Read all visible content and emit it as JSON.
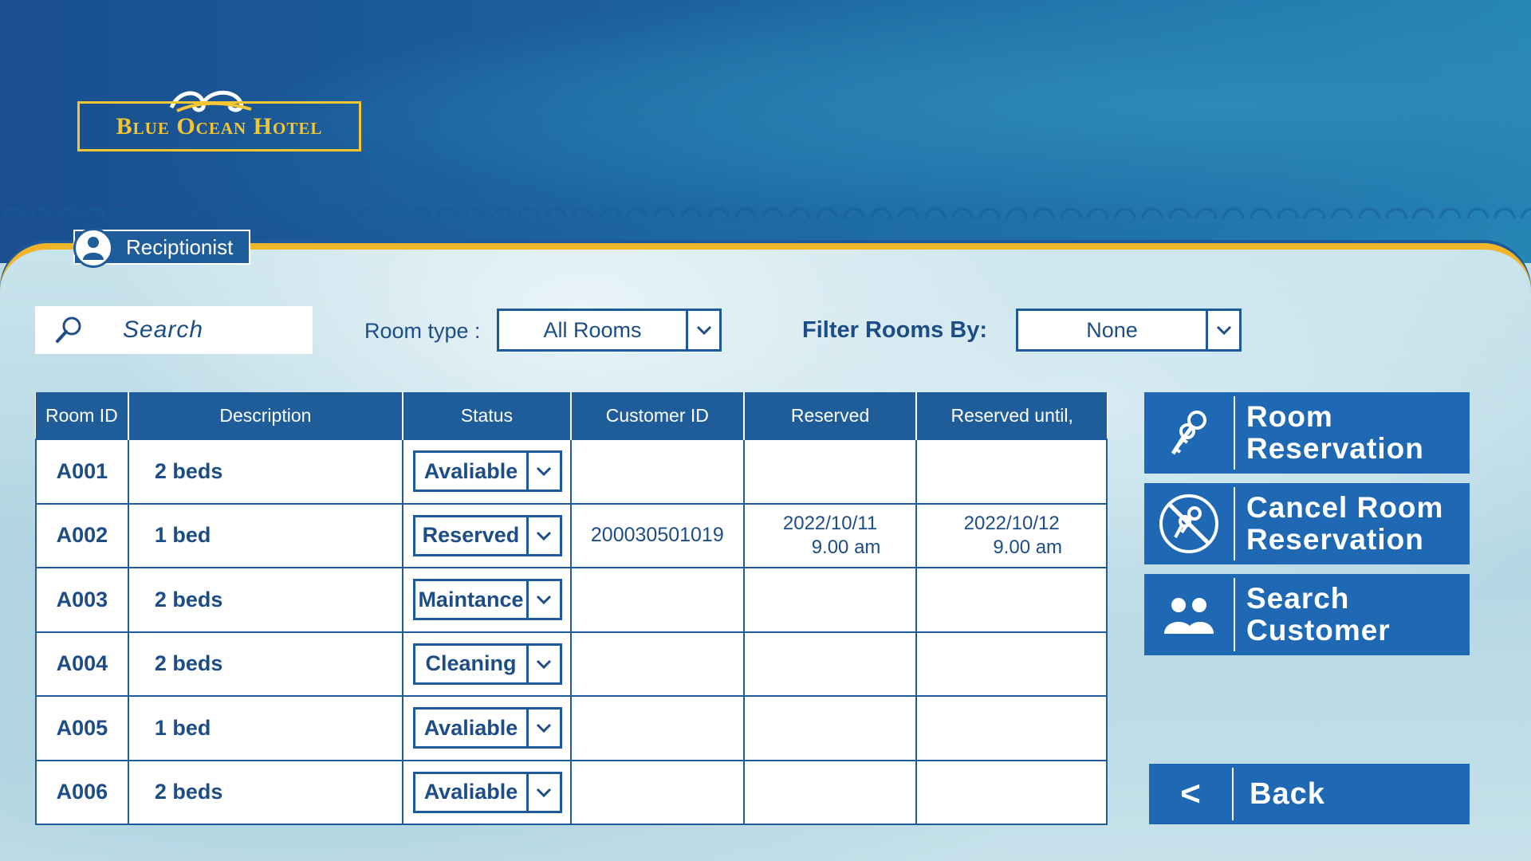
{
  "brand": {
    "name": "Blue Ocean Hotel"
  },
  "user": {
    "role": "Reciptionist"
  },
  "filters": {
    "search_placeholder": "Search",
    "room_type_label": "Room type :",
    "room_type_value": "All Rooms",
    "filter_by_label": "Filter Rooms By:",
    "filter_by_value": "None"
  },
  "table": {
    "headers": [
      "Room ID",
      "Description",
      "Status",
      "Customer ID",
      "Reserved",
      "Reserved until,"
    ],
    "rows": [
      {
        "id": "A001",
        "description": "2 beds",
        "status": "Avaliable",
        "customer_id": "",
        "reserved_date": "",
        "reserved_time": "",
        "until_date": "",
        "until_time": ""
      },
      {
        "id": "A002",
        "description": "1 bed",
        "status": "Reserved",
        "customer_id": "200030501019",
        "reserved_date": "2022/10/11",
        "reserved_time": "9.00 am",
        "until_date": "2022/10/12",
        "until_time": "9.00 am"
      },
      {
        "id": "A003",
        "description": "2 beds",
        "status": "Maintance",
        "customer_id": "",
        "reserved_date": "",
        "reserved_time": "",
        "until_date": "",
        "until_time": ""
      },
      {
        "id": "A004",
        "description": "2 beds",
        "status": "Cleaning",
        "customer_id": "",
        "reserved_date": "",
        "reserved_time": "",
        "until_date": "",
        "until_time": ""
      },
      {
        "id": "A005",
        "description": "1 bed",
        "status": "Avaliable",
        "customer_id": "",
        "reserved_date": "",
        "reserved_time": "",
        "until_date": "",
        "until_time": ""
      },
      {
        "id": "A006",
        "description": "2 beds",
        "status": "Avaliable",
        "customer_id": "",
        "reserved_date": "",
        "reserved_time": "",
        "until_date": "",
        "until_time": ""
      }
    ]
  },
  "actions": {
    "room_reservation": "Room Reservation",
    "cancel_reservation": "Cancel Room Reservation",
    "search_customer": "Search Customer",
    "back": "Back",
    "back_glyph": "<"
  },
  "icons": {
    "search": "search-icon",
    "user": "user-icon",
    "dropdown": "chevron-down-icon",
    "keys": "keys-icon",
    "no_keys": "cancel-keys-icon",
    "people": "people-icon"
  },
  "colors": {
    "primary": "#1e5d9a",
    "button": "#1f68b4",
    "accent": "#f2b52a",
    "text": "#1d4d86"
  }
}
